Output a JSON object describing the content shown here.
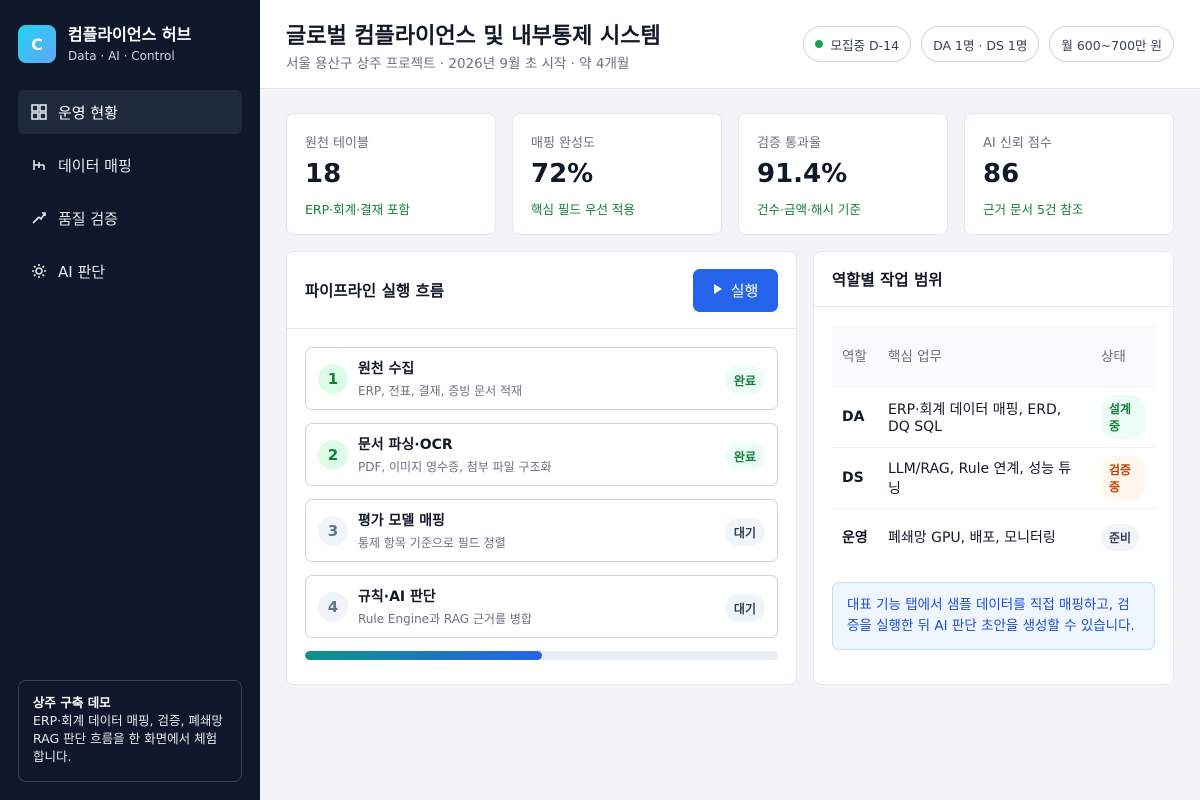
{
  "brand": {
    "logo_letter": "C",
    "title": "컴플라이언스 허브",
    "subtitle": "Data · AI · Control"
  },
  "nav": [
    {
      "label": "운영 현황",
      "icon": "dashboard-icon",
      "active": true
    },
    {
      "label": "데이터 매핑",
      "icon": "mapping-icon",
      "active": false
    },
    {
      "label": "품질 검증",
      "icon": "check-icon",
      "active": false
    },
    {
      "label": "AI 판단",
      "icon": "gear-icon",
      "active": false
    }
  ],
  "demo": {
    "title": "상주 구축 데모",
    "text": "ERP·회계 데이터 매핑, 검증, 폐쇄망 RAG 판단 흐름을 한 화면에서 체험합니다."
  },
  "header": {
    "title": "글로벌 컴플라이언스 및 내부통제 시스템",
    "subtitle": "서울 용산구 상주 프로젝트 · 2026년 9월 초 시작 · 약 4개월",
    "chips": [
      "모집중 D-14",
      "DA 1명 · DS 1명",
      "월 600~700만 원"
    ],
    "status_color": "#16a34a"
  },
  "kpis": [
    {
      "label": "원천 테이블",
      "value": "18",
      "note": "ERP·회계·결재 포함"
    },
    {
      "label": "매핑 완성도",
      "value": "72%",
      "note": "핵심 필드 우선 적용"
    },
    {
      "label": "검증 통과율",
      "value": "91.4%",
      "note": "건수·금액·해시 기준"
    },
    {
      "label": "AI 신뢰 점수",
      "value": "86",
      "note": "근거 문서 5건 참조"
    }
  ],
  "pipeline": {
    "title": "파이프라인 실행 흐름",
    "run_label": "실행",
    "steps": [
      {
        "num": "1",
        "title": "원천 수집",
        "desc": "ERP, 전표, 결재, 증빙 문서 적재",
        "status": "완료"
      },
      {
        "num": "2",
        "title": "문서 파싱·OCR",
        "desc": "PDF, 이미지 영수증, 첨부 파일 구조화",
        "status": "완료"
      },
      {
        "num": "3",
        "title": "평가 모델 매핑",
        "desc": "통제 항목 기준으로 필드 정렬",
        "status": "대기"
      },
      {
        "num": "4",
        "title": "규칙·AI 판단",
        "desc": "Rule Engine과 RAG 근거를 병합",
        "status": "대기"
      }
    ],
    "progress": 0.5
  },
  "roles": {
    "title": "역할별 작업 범위",
    "headers": [
      "역할",
      "핵심 업무",
      "상태"
    ],
    "rows": [
      {
        "role": "DA",
        "task": "ERP·회계 데이터 매핑, ERD, DQ SQL",
        "status": "설계중"
      },
      {
        "role": "DS",
        "task": "LLM/RAG, Rule 연계, 성능 튜닝",
        "status": "검증중"
      },
      {
        "role": "운영",
        "task": "폐쇄망 GPU, 배포, 모니터링",
        "status": "준비"
      }
    ],
    "info": "대표 기능 탭에서 샘플 데이터를 직접 매핑하고, 검증을 실행한 뒤 AI 판단 초안을 생성할 수 있습니다."
  }
}
